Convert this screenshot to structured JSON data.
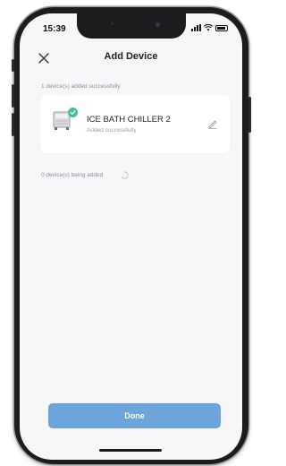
{
  "status_bar": {
    "time": "15:39"
  },
  "header": {
    "title": "Add Device",
    "close_icon": "close-icon"
  },
  "added_section": {
    "label": "1 device(s) added successfully",
    "devices": [
      {
        "name": "ICE BATH CHILLER 2",
        "status": "Added successfully",
        "icon": "chiller-device-icon",
        "badge_icon": "check-icon",
        "edit_icon": "edit-icon"
      }
    ]
  },
  "adding_section": {
    "label": "0 device(s) being added",
    "spinner_icon": "loading-spinner-icon"
  },
  "footer": {
    "done_label": "Done"
  },
  "colors": {
    "accent": "#6da4dc",
    "success": "#44c08d",
    "background": "#f6f7f9",
    "muted_text": "#8a8d94"
  }
}
